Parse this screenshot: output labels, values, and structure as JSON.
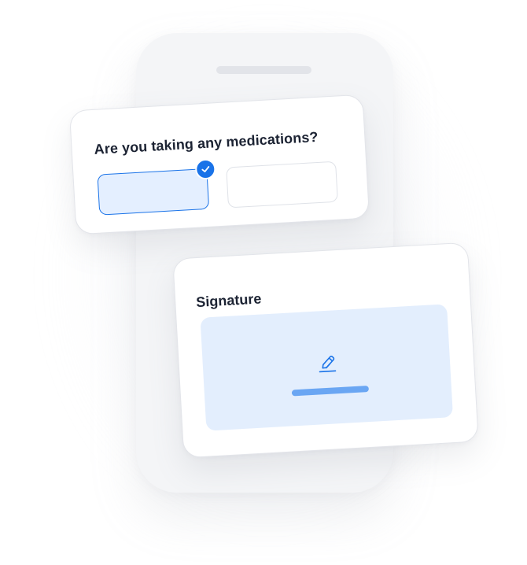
{
  "question_card": {
    "title": "Are you taking any medications?",
    "options": [
      {
        "selected": true
      },
      {
        "selected": false
      }
    ]
  },
  "signature_card": {
    "title": "Signature"
  },
  "colors": {
    "accent": "#1a73e8",
    "selected_fill": "#e4efff",
    "signature_pad": "#e3eefd",
    "signature_line": "#6aa6f3",
    "title_text": "#1c2333",
    "phone_body": "#f4f5f7"
  },
  "icons": {
    "check": "check-icon",
    "pen": "pen-icon"
  }
}
